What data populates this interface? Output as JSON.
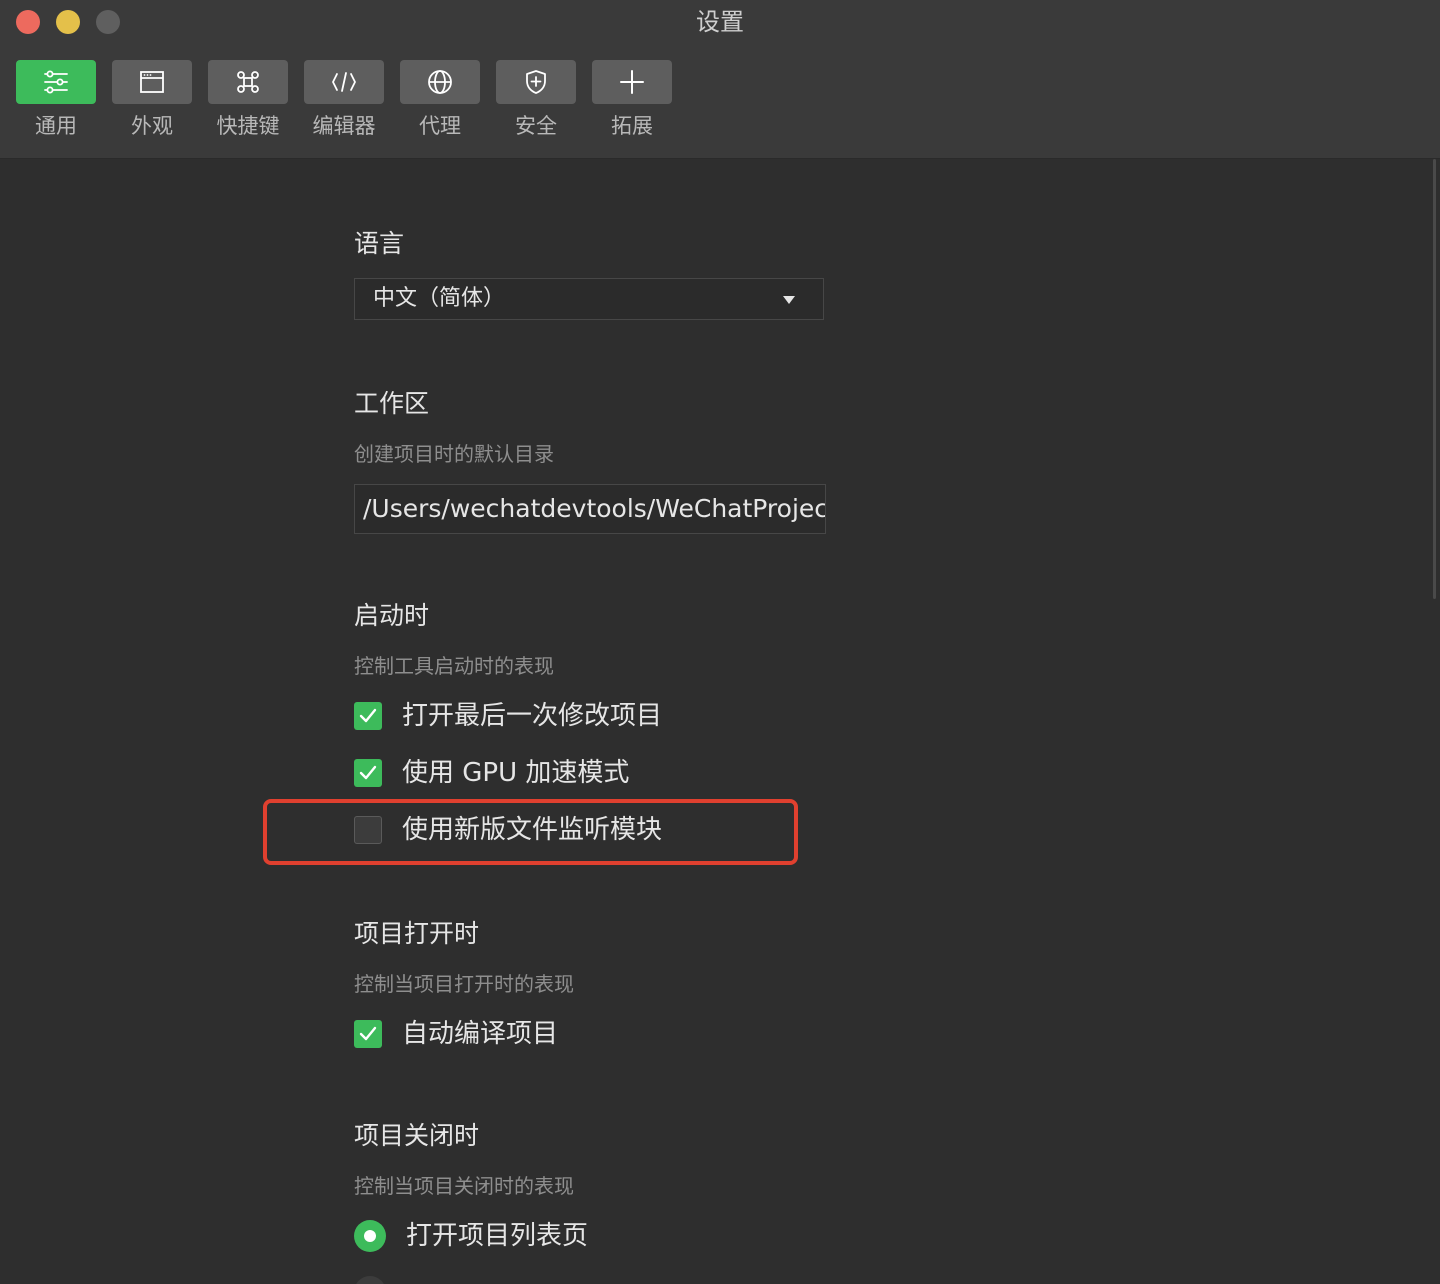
{
  "window": {
    "title": "设置"
  },
  "toolbar": {
    "tabs": [
      {
        "label": "通用",
        "icon": "sliders-icon",
        "active": true
      },
      {
        "label": "外观",
        "icon": "window-icon",
        "active": false
      },
      {
        "label": "快捷键",
        "icon": "command-key-icon",
        "active": false
      },
      {
        "label": "编辑器",
        "icon": "code-icon",
        "active": false
      },
      {
        "label": "代理",
        "icon": "globe-icon",
        "active": false
      },
      {
        "label": "安全",
        "icon": "shield-icon",
        "active": false
      },
      {
        "label": "拓展",
        "icon": "plus-icon",
        "active": false
      }
    ]
  },
  "language": {
    "heading": "语言",
    "selected": "中文（简体）"
  },
  "workspace": {
    "heading": "工作区",
    "description": "创建项目时的默认目录",
    "path": "/Users/wechatdevtools/WeChatProjects"
  },
  "startup": {
    "heading": "启动时",
    "description": "控制工具启动时的表现",
    "options": [
      {
        "label": "打开最后一次修改项目",
        "checked": true
      },
      {
        "label": "使用 GPU 加速模式",
        "checked": true
      },
      {
        "label": "使用新版文件监听模块",
        "checked": false
      }
    ]
  },
  "project_open": {
    "heading": "项目打开时",
    "description": "控制当项目打开时的表现",
    "options": [
      {
        "label": "自动编译项目",
        "checked": true
      }
    ]
  },
  "project_close": {
    "heading": "项目关闭时",
    "description": "控制当项目关闭时的表现",
    "options": [
      {
        "label": "打开项目列表页",
        "selected": true
      }
    ]
  },
  "colors": {
    "accent": "#3dbb5b",
    "highlight_border": "#e0402f",
    "background": "#2e2e2e",
    "toolbar": "#3a3a3a"
  }
}
